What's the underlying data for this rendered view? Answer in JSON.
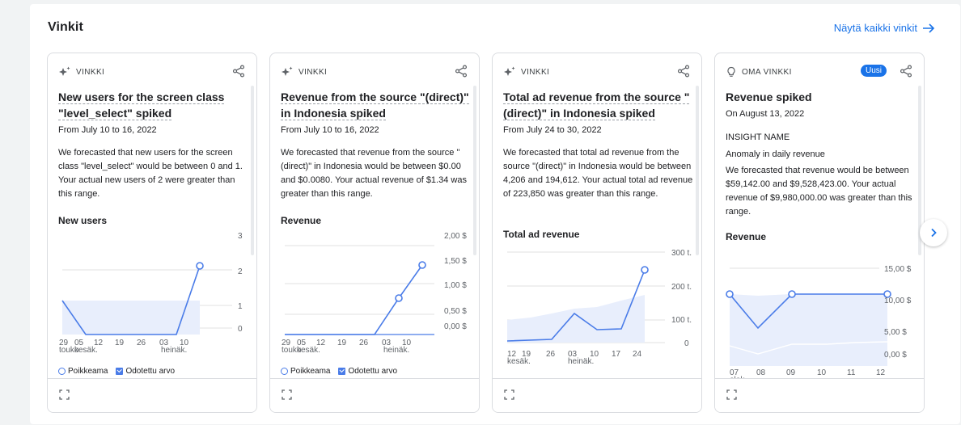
{
  "panel": {
    "title": "Vinkit",
    "view_all": "Näytä kaikki vinkit"
  },
  "legend": {
    "anomaly": "Poikkeama",
    "expected": "Odotettu arvo"
  },
  "cards": [
    {
      "kicker": "VINKKI",
      "title": "New users for the screen class \"level_select\" spiked",
      "date": "From July 10 to 16, 2022",
      "body": "We forecasted that new users for the screen class \"level_select\" would be between 0 and 1. Your actual new users of 2 were greater than this range.",
      "metric": "New users"
    },
    {
      "kicker": "VINKKI",
      "title": "Revenue from the source \"(direct)\" in Indonesia spiked",
      "date": "From July 10 to 16, 2022",
      "body": "We forecasted that revenue from the source \"(direct)\" in Indonesia would be between $0.00 and $0.0080. Your actual revenue of $1.34 was greater than this range.",
      "metric": "Revenue"
    },
    {
      "kicker": "VINKKI",
      "title": "Total ad revenue from the source \"(direct)\" in Indonesia spiked",
      "date": "From July 24 to 30, 2022",
      "body": "We forecasted that total ad revenue from the source \"(direct)\" in Indonesia would be between 4,206 and 194,612. Your actual total ad revenue of 223,850 was greater than this range.",
      "metric": "Total ad revenue"
    },
    {
      "kicker": "OMA VINKKI",
      "badge": "Uusi",
      "title": "Revenue spiked",
      "date": "On August 13, 2022",
      "insight_label": "INSIGHT NAME",
      "insight_name": "Anomaly in daily revenue",
      "body": "We forecasted that revenue would be between $59,142.00 and $9,528,423.00. Your actual revenue of $9,980,000.00 was greater than this range.",
      "metric": "Revenue"
    }
  ],
  "chart_data": [
    {
      "type": "line",
      "x": [
        "29",
        "05",
        "12",
        "19",
        "26",
        "03",
        "10"
      ],
      "x_months": [
        "touko",
        "kesäk.",
        "heinäk."
      ],
      "values": [
        1,
        0,
        0,
        0,
        0,
        0,
        2.2
      ],
      "expected_band": [
        [
          0,
          1
        ],
        [
          0,
          1
        ],
        [
          0,
          1
        ],
        [
          0,
          1
        ],
        [
          0,
          1
        ],
        [
          0,
          1
        ],
        [
          0,
          1
        ]
      ],
      "yticks": [
        "3",
        "2",
        "1",
        "0"
      ],
      "ylim": [
        0,
        3
      ],
      "color": "#4a7ce8"
    },
    {
      "type": "line",
      "x": [
        "29",
        "05",
        "12",
        "19",
        "26",
        "03",
        "10"
      ],
      "x_months": [
        "touko",
        "kesäk.",
        "heinäk."
      ],
      "values": [
        0,
        0,
        0,
        0,
        0,
        0.7,
        1.34
      ],
      "yticks": [
        "2,00 $",
        "1,50 $",
        "1,00 $",
        "0,50 $",
        "0,00 $"
      ],
      "ylim": [
        0,
        2
      ],
      "color": "#4a7ce8"
    },
    {
      "type": "line",
      "x": [
        "12",
        "19",
        "26",
        "03",
        "10",
        "17",
        "24"
      ],
      "x_months": [
        "kesäk.",
        "heinäk."
      ],
      "values": [
        40,
        45,
        110,
        60,
        60,
        223.85
      ],
      "yticks": [
        "300 t.",
        "200 t.",
        "100 t.",
        "0"
      ],
      "ylim": [
        0,
        300
      ],
      "color": "#4a7ce8"
    },
    {
      "type": "line",
      "x": [
        "07",
        "08",
        "09",
        "10",
        "11",
        "12"
      ],
      "x_months": [
        "elok"
      ],
      "values": [
        9.98,
        5.8,
        9.98,
        9.98,
        9.98,
        9.98
      ],
      "yticks": [
        "15,00 $",
        "10,00 $",
        "5,00 $",
        "0,00 $"
      ],
      "ylim": [
        0,
        15
      ],
      "color": "#4a7ce8"
    }
  ]
}
